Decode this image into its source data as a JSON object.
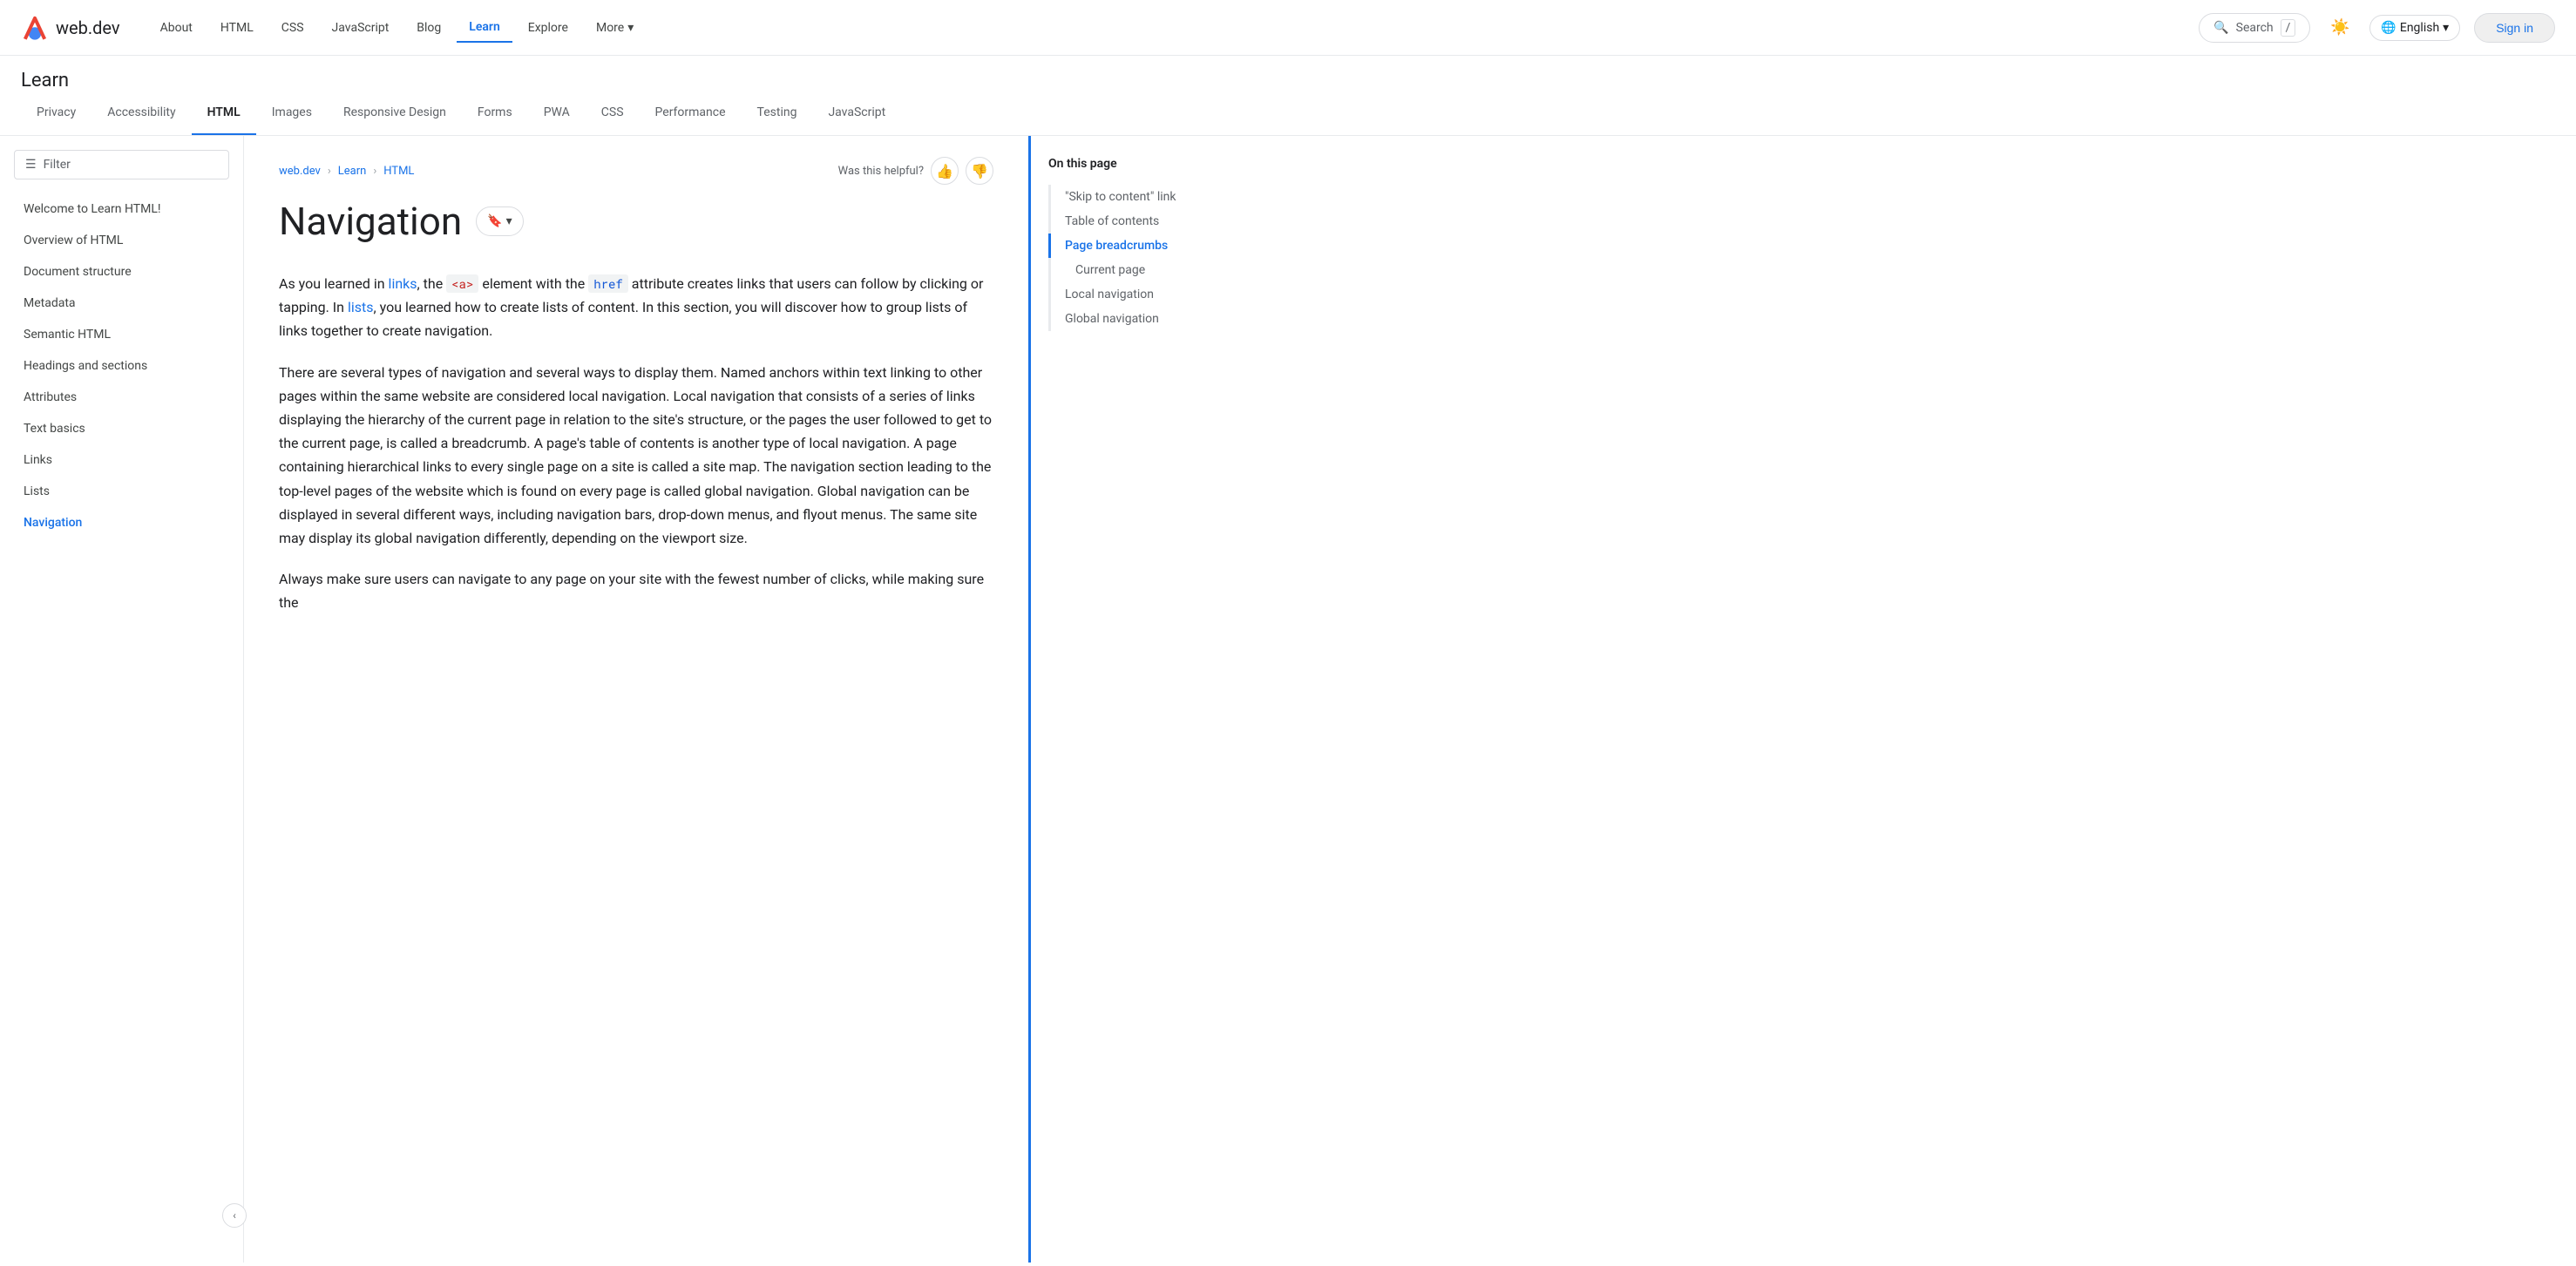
{
  "topNav": {
    "logo": "web.dev",
    "links": [
      {
        "label": "About",
        "active": false
      },
      {
        "label": "HTML",
        "active": false
      },
      {
        "label": "CSS",
        "active": false
      },
      {
        "label": "JavaScript",
        "active": false
      },
      {
        "label": "Blog",
        "active": false
      },
      {
        "label": "Learn",
        "active": true
      },
      {
        "label": "Explore",
        "active": false
      },
      {
        "label": "More",
        "active": false
      }
    ],
    "searchPlaceholder": "Search",
    "searchShortcut": "/",
    "language": "English",
    "signIn": "Sign in"
  },
  "learnHeader": {
    "title": "Learn"
  },
  "tabs": [
    {
      "label": "Privacy",
      "active": false
    },
    {
      "label": "Accessibility",
      "active": false
    },
    {
      "label": "HTML",
      "active": true
    },
    {
      "label": "Images",
      "active": false
    },
    {
      "label": "Responsive Design",
      "active": false
    },
    {
      "label": "Forms",
      "active": false
    },
    {
      "label": "PWA",
      "active": false
    },
    {
      "label": "CSS",
      "active": false
    },
    {
      "label": "Performance",
      "active": false
    },
    {
      "label": "Testing",
      "active": false
    },
    {
      "label": "JavaScript",
      "active": false
    }
  ],
  "sidebar": {
    "filterPlaceholder": "Filter",
    "items": [
      {
        "label": "Welcome to Learn HTML!",
        "active": false
      },
      {
        "label": "Overview of HTML",
        "active": false
      },
      {
        "label": "Document structure",
        "active": false
      },
      {
        "label": "Metadata",
        "active": false
      },
      {
        "label": "Semantic HTML",
        "active": false
      },
      {
        "label": "Headings and sections",
        "active": false
      },
      {
        "label": "Attributes",
        "active": false
      },
      {
        "label": "Text basics",
        "active": false
      },
      {
        "label": "Links",
        "active": false
      },
      {
        "label": "Lists",
        "active": false
      },
      {
        "label": "Navigation",
        "active": true
      }
    ]
  },
  "breadcrumb": {
    "items": [
      "web.dev",
      "Learn",
      "HTML"
    ]
  },
  "helpful": {
    "label": "Was this helpful?"
  },
  "article": {
    "title": "Navigation",
    "bookmarkLabel": "▾",
    "body": [
      {
        "type": "paragraph",
        "parts": [
          {
            "text": "As you learned in ",
            "type": "normal"
          },
          {
            "text": "links",
            "type": "link"
          },
          {
            "text": ", the ",
            "type": "normal"
          },
          {
            "text": "<a>",
            "type": "code"
          },
          {
            "text": " element with the ",
            "type": "normal"
          },
          {
            "text": "href",
            "type": "code-attr"
          },
          {
            "text": " attribute creates links that users can follow by clicking or tapping. In ",
            "type": "normal"
          },
          {
            "text": "lists",
            "type": "link"
          },
          {
            "text": ", you learned how to create lists of content. In this section, you will discover how to group lists of links together to create navigation.",
            "type": "normal"
          }
        ]
      },
      {
        "type": "paragraph",
        "text": "There are several types of navigation and several ways to display them. Named anchors within text linking to other pages within the same website are considered local navigation. Local navigation that consists of a series of links displaying the hierarchy of the current page in relation to the site's structure, or the pages the user followed to get to the current page, is called a breadcrumb. A page's table of contents is another type of local navigation. A page containing hierarchical links to every single page on a site is called a site map. The navigation section leading to the top-level pages of the website which is found on every page is called global navigation. Global navigation can be displayed in several different ways, including navigation bars, drop-down menus, and flyout menus. The same site may display its global navigation differently, depending on the viewport size."
      },
      {
        "type": "paragraph",
        "text": "Always make sure users can navigate to any page on your site with the fewest number of clicks, while making sure the"
      }
    ]
  },
  "toc": {
    "title": "On this page",
    "items": [
      {
        "label": "\"Skip to content\" link",
        "active": false,
        "sub": false
      },
      {
        "label": "Table of contents",
        "active": false,
        "sub": false
      },
      {
        "label": "Page breadcrumbs",
        "active": true,
        "sub": false
      },
      {
        "label": "Current page",
        "active": false,
        "sub": true
      },
      {
        "label": "Local navigation",
        "active": false,
        "sub": false
      },
      {
        "label": "Global navigation",
        "active": false,
        "sub": false
      }
    ]
  },
  "collapseBtn": "‹"
}
